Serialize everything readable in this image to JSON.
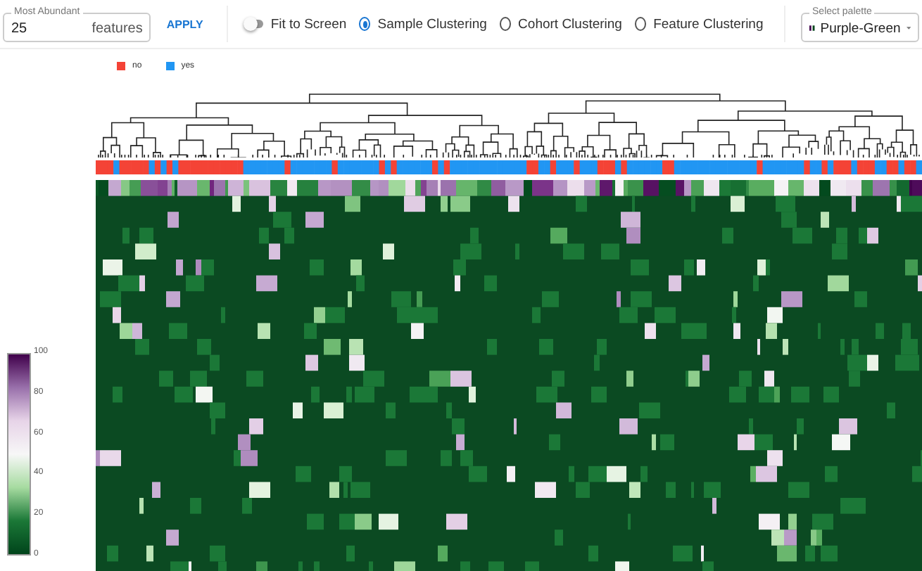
{
  "controls": {
    "most_abundant": {
      "label": "Most Abundant",
      "value": "25",
      "suffix": "features"
    },
    "apply_button": "APPLY",
    "fit_to_screen": {
      "label": "Fit to Screen",
      "on": false
    },
    "clustering": [
      {
        "label": "Sample Clustering",
        "selected": true
      },
      {
        "label": "Cohort Clustering",
        "selected": false
      },
      {
        "label": "Feature Clustering",
        "selected": false
      }
    ],
    "palette": {
      "label": "Select palette",
      "value": "Purple-Green"
    }
  },
  "legend": [
    {
      "label": "no",
      "color": "#f44336"
    },
    {
      "label": "yes",
      "color": "#2196f3"
    }
  ],
  "colorbar": {
    "ticks": [
      "100",
      "80",
      "60",
      "40",
      "20",
      "0"
    ]
  }
}
